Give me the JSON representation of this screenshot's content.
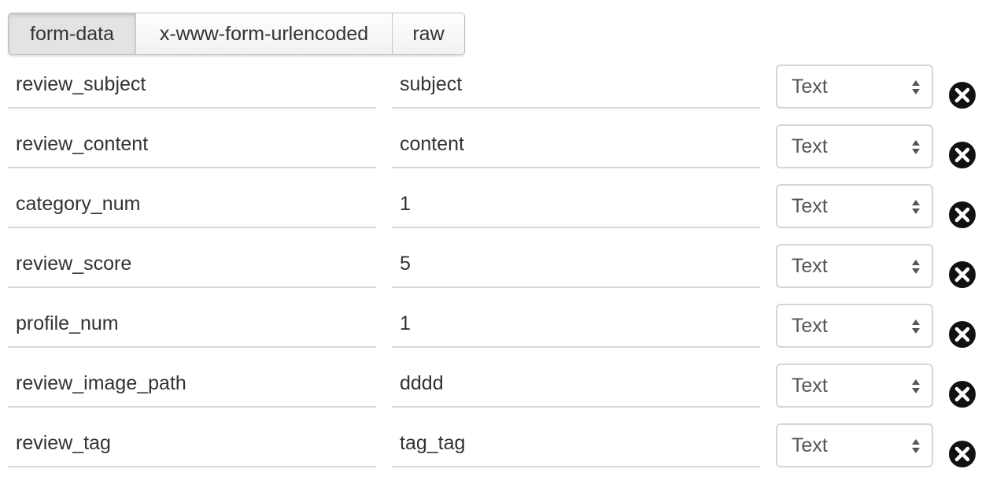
{
  "tabs": [
    {
      "label": "form-data",
      "active": true
    },
    {
      "label": "x-www-form-urlencoded",
      "active": false
    },
    {
      "label": "raw",
      "active": false
    }
  ],
  "rows": [
    {
      "key": "review_subject",
      "value": "subject",
      "type": "Text"
    },
    {
      "key": "review_content",
      "value": "content",
      "type": "Text"
    },
    {
      "key": "category_num",
      "value": "1",
      "type": "Text"
    },
    {
      "key": "review_score",
      "value": "5",
      "type": "Text"
    },
    {
      "key": "profile_num",
      "value": "1",
      "type": "Text"
    },
    {
      "key": "review_image_path",
      "value": "dddd",
      "type": "Text"
    },
    {
      "key": "review_tag",
      "value": "tag_tag",
      "type": "Text"
    }
  ],
  "icons": {
    "delete": "close-circle-icon",
    "select_arrows": "updown-arrows-icon"
  },
  "colors": {
    "text": "#333333",
    "border": "#d8d8d8",
    "active_tab": "#e3e3e3",
    "delete_icon": "#111111"
  }
}
